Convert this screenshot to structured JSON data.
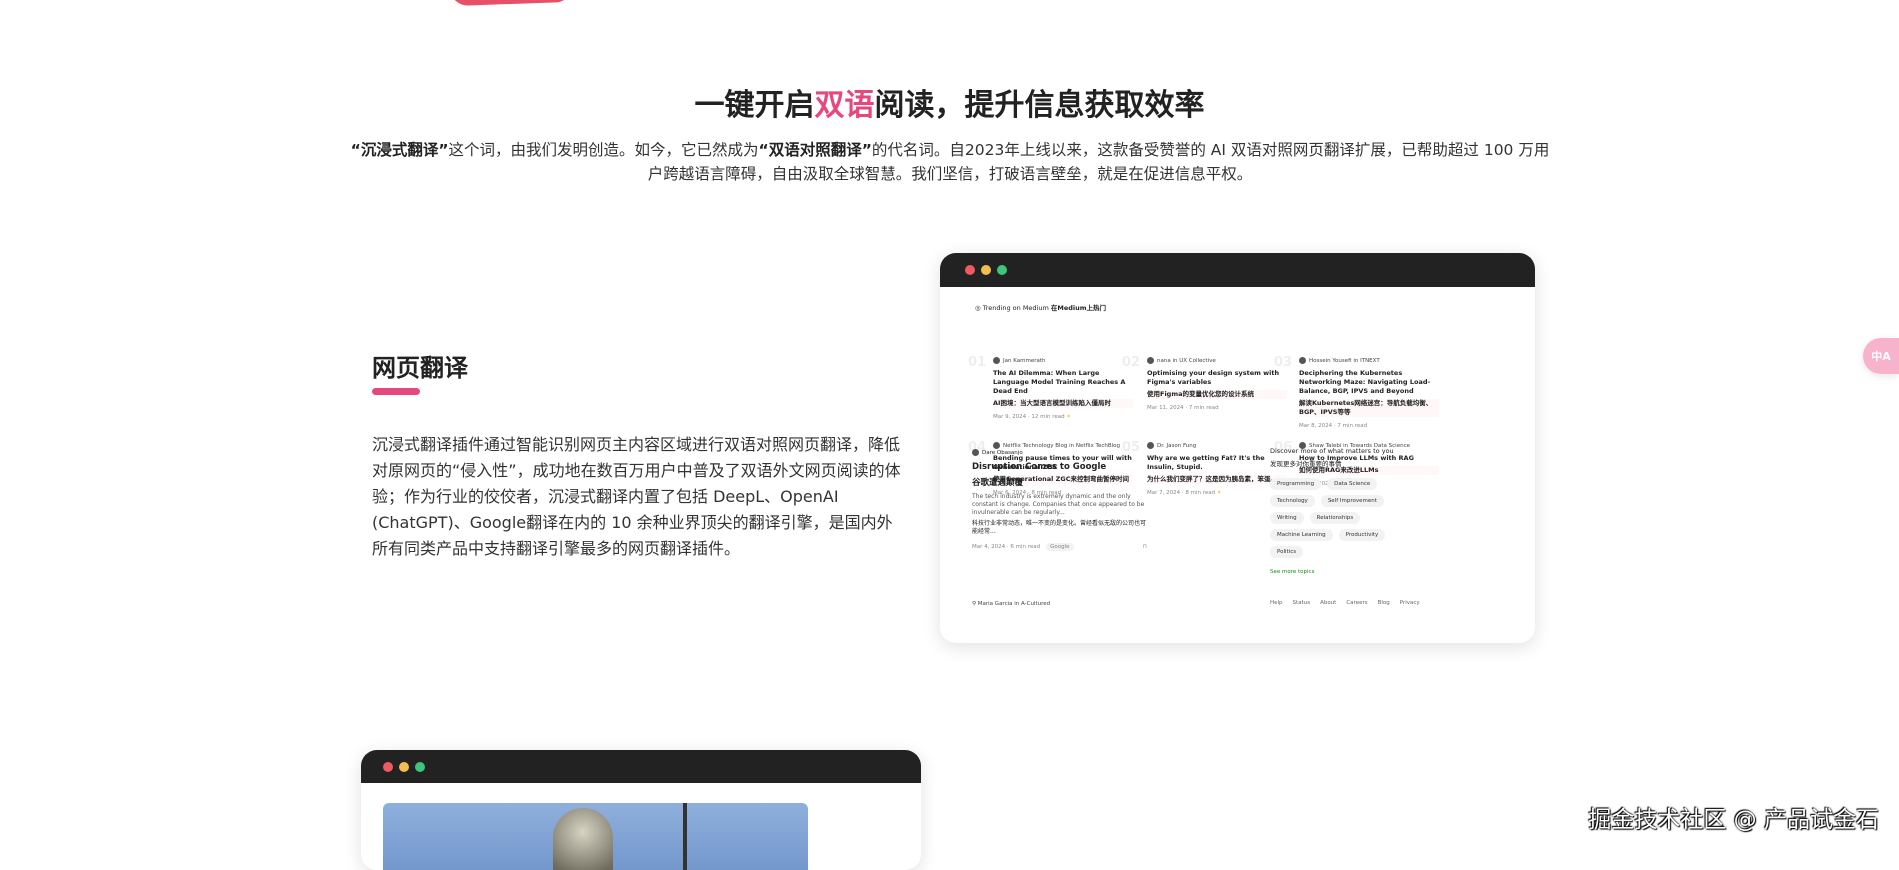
{
  "hero": {
    "title_pre": "一键开启",
    "title_hl": "双语",
    "title_post": "阅读，提升信息获取效率",
    "intro": {
      "q1": "“沉浸式翻译”",
      "p1": "这个词，由我们发明创造。如今，它已然成为",
      "q2": "“双语对照翻译”",
      "p2": "的代名词。自2023年上线以来，这款备受赞誉的 AI 双语对照网页翻译扩展，已帮助超过 100 万用户跨越语言障碍，自由汲取全球智慧。我们坚信，打破语言壁垒，就是在促进信息平权。"
    }
  },
  "section": {
    "title": "网页翻译",
    "desc": "沉浸式翻译插件通过智能识别网页主内容区域进行双语对照网页翻译，降低对原网页的“侵入性”，成功地在数百万用户中普及了双语外文网页阅读的体验；作为行业的佼佼者，沉浸式翻译内置了包括 DeepL、OpenAI (ChatGPT)、Google翻译在内的 10 余种业界顶尖的翻译引擎，是国内外所有同类产品中支持翻译引擎最多的网页翻译插件。"
  },
  "colors": {
    "accent": "#e5487f",
    "dot_red": "#ee5a5f",
    "dot_yellow": "#f4bd4f",
    "dot_green": "#3fc57a",
    "titlebar": "#222222"
  },
  "mock": {
    "trending_en": "Trending on Medium",
    "trending_zh": "在Medium上热门",
    "articles": [
      {
        "num": "01",
        "author": "Jan Kammerath",
        "title": "The AI Dilemma: When Large Language Model Training Reaches A Dead End",
        "title_zh": "AI困境：当大型语言模型训练陷入僵局时",
        "meta": "Mar 9, 2024 · 12 min read",
        "star": "✦"
      },
      {
        "num": "02",
        "author": "nana in UX Collective",
        "title": "Optimising your design system with Figma's variables",
        "title_zh": "使用Figma的变量优化您的设计系统",
        "meta": "Mar 11, 2024 · 7 min read",
        "star": ""
      },
      {
        "num": "03",
        "author": "Hossein Yousefi in ITNEXT",
        "title": "Deciphering the Kubernetes Networking Maze: Navigating Load-Balance, BGP, IPVS and Beyond",
        "title_zh": "解读Kubernetes网络迷宫：导航负载均衡、BGP、IPVS等等",
        "meta": "Mar 8, 2024 · 7 min read",
        "star": ""
      },
      {
        "num": "04",
        "author": "Netflix Technology Blog in Netflix TechBlog",
        "title": "Bending pause times to your will with Generational ZGC",
        "title_zh": "使用Generational ZGC来控制弯曲暂停时间",
        "meta": "Mar 6, 2024 · 8 min read",
        "star": ""
      },
      {
        "num": "05",
        "author": "Dr. Jason Fung",
        "title": "Why are we getting Fat? It's the Insulin, Stupid.",
        "title_zh": "为什么我们变胖了？这是因为胰岛素，笨蛋。",
        "meta": "Mar 7, 2024 · 8 min read",
        "star": "✦"
      },
      {
        "num": "06",
        "author": "Shaw Talebi in Towards Data Science",
        "title": "How to Improve LLMs with RAG",
        "title_zh": "如何使用RAG来改进LLMs",
        "meta": "Mar 5, 2024 · 12 min read",
        "star": "✦"
      }
    ],
    "feature": {
      "author": "Dare Obasanjo",
      "title": "Disruption Comes to Google",
      "title_zh": "谷歌遭遇颠覆",
      "excerpt": "The tech industry is extremely dynamic and the only constant is change. Companies that once appeared to be invulnerable can be regularly...",
      "excerpt_zh": "科技行业非常动态，唯一不变的是变化。曾经看似无敌的公司也可能经常...",
      "meta": "Mar 4, 2024 · 6 min read",
      "tag": "Google"
    },
    "next_author": "Maria Garcia in A-Cultured",
    "discover": {
      "title": "Discover more of what matters to you",
      "title_zh": "发现更多对你重要的事情",
      "topics": [
        "Programming",
        "Data Science",
        "Technology",
        "Self Improvement",
        "Writing",
        "Relationships",
        "Machine Learning",
        "Productivity",
        "Politics"
      ],
      "more": "See more topics"
    },
    "footer": [
      "Help",
      "Status",
      "About",
      "Careers",
      "Blog",
      "Privacy"
    ]
  },
  "fab": {
    "label": "中A"
  },
  "watermark": "掘金技术社区 @ 产品试金石"
}
